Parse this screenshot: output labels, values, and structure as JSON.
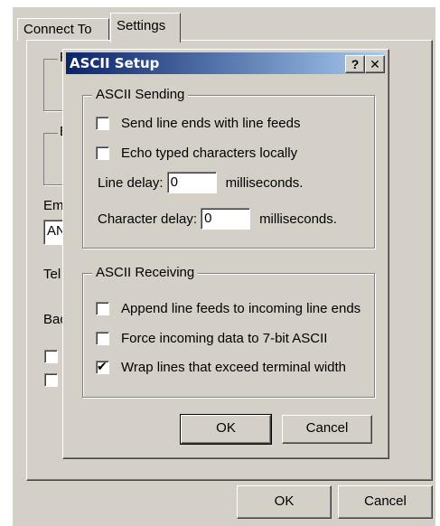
{
  "background_dialog": {
    "tabs": [
      "Connect To",
      "Settings"
    ],
    "partial_labels": [
      "F",
      "E",
      "Em",
      "AN",
      "Tel",
      "Bac"
    ],
    "ok_label": "OK",
    "cancel_label": "Cancel"
  },
  "ascii_setup": {
    "title": "ASCII Setup",
    "help_glyph": "?",
    "close_glyph": "✕",
    "sending": {
      "legend": "ASCII Sending",
      "options": [
        {
          "label": "Send line ends with line feeds",
          "checked": false
        },
        {
          "label": "Echo typed characters locally",
          "checked": false
        }
      ],
      "line_delay": {
        "label": "Line delay:",
        "value": "0",
        "unit": "milliseconds."
      },
      "char_delay": {
        "label": "Character delay:",
        "value": "0",
        "unit": "milliseconds."
      }
    },
    "receiving": {
      "legend": "ASCII Receiving",
      "options": [
        {
          "label": "Append line feeds to incoming line ends",
          "checked": false
        },
        {
          "label": "Force incoming data to 7-bit ASCII",
          "checked": false
        },
        {
          "label": "Wrap lines that exceed terminal width",
          "checked": true
        }
      ]
    },
    "ok_label": "OK",
    "cancel_label": "Cancel",
    "check_glyph": "✔"
  }
}
